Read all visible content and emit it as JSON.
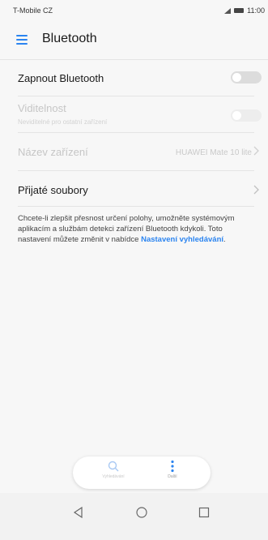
{
  "status_bar": {
    "carrier": "T-Mobile CZ",
    "time": "11:00"
  },
  "header": {
    "title": "Bluetooth"
  },
  "settings": {
    "bluetooth_toggle": {
      "label": "Zapnout Bluetooth",
      "state": "off"
    },
    "visibility": {
      "label": "Viditelnost",
      "sublabel": "Neviditelné pro ostatní zařízení",
      "state": "off",
      "enabled": false
    },
    "device_name": {
      "label": "Název zařízení",
      "value": "HUAWEI Mate 10 lite",
      "enabled": false
    },
    "received_files": {
      "label": "Přijaté soubory"
    }
  },
  "info": {
    "text": "Chcete-li zlepšit přesnost určení polohy, umožněte systémovým aplikacím a službám detekci zařízení Bluetooth kdykoli. Toto nastavení můžete změnit v nabídce ",
    "link": "Nastavení vyhledávání",
    "suffix": "."
  },
  "bottom_menu": {
    "search_label": "Vyhledávání",
    "more_label": "Další"
  },
  "colors": {
    "accent": "#2b84f0",
    "background": "#f7f7f7",
    "toggle_off": "#dcdcdc"
  },
  "icons": [
    "menu-icon",
    "signal-icon",
    "battery-icon",
    "chevron-right-icon",
    "search-icon",
    "more-vertical-icon",
    "back-icon",
    "home-icon",
    "recent-apps-icon"
  ]
}
